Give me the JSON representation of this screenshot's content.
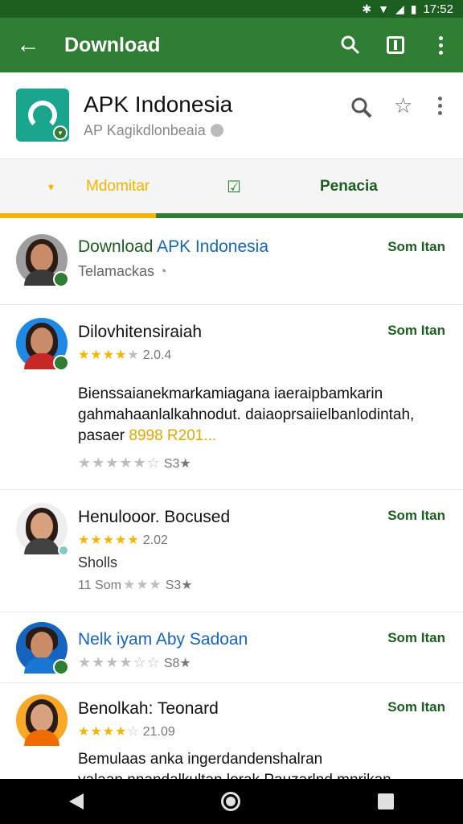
{
  "status_bar": {
    "time": "17:52",
    "icons": [
      "bluetooth-icon",
      "wifi-icon",
      "signal-icon",
      "battery-icon"
    ]
  },
  "appbar": {
    "title": "Download",
    "back_icon": "arrow-back-icon",
    "actions": [
      "search-icon",
      "book-icon",
      "more-icon"
    ]
  },
  "app_header": {
    "name": "APK Indonesia",
    "subtitle": "AP Kagikdlonbeaia"
  },
  "tabs": [
    {
      "label": "Mdomitar",
      "icon": "chevron-down-icon",
      "color": "#f4b400"
    },
    {
      "label": "",
      "icon": "checkbox-icon"
    },
    {
      "label": "Penacia"
    }
  ],
  "items": [
    {
      "title": "Download ",
      "title_blue": "APK Indonesia",
      "action": "Som Itan",
      "subtitle": "Telamackas"
    },
    {
      "title": "Dilovhitensiraiah",
      "action": "Som Itan",
      "rating": "2.0.4",
      "stars_on": 4,
      "body_line1": "Bienssaianekmarkamiagana iaeraipbamkarin",
      "body_line2": "gahmahaanlalkahnodut. daiaoprsaiielbanlodintah,",
      "body_line3_a": "pasaer ",
      "body_line3_b": "8998 R201...",
      "bottom_rating": "S3★"
    },
    {
      "title": "Henulooor. Bocused",
      "action": "Som Itan",
      "rating": "2.02",
      "stars_on": 5,
      "body": "Sholls",
      "meta": "11 Som",
      "bottom_rating": "S3★"
    },
    {
      "title": "Nelk iyam Aby Sadoan",
      "action": "Som Itan",
      "bottom_rating": "S8★"
    },
    {
      "title": "Benolkah: Teonard",
      "action": "Som Itan",
      "rating": "21.09",
      "stars_on": 4,
      "body_line1": "Bemulaas anka ingerdandenshalran",
      "body_line2": "valaan nnandalkultan lorak Pauzarlnd mnrikan"
    }
  ],
  "colors": {
    "accent": "#2e7d32",
    "highlight": "#f4b400"
  }
}
